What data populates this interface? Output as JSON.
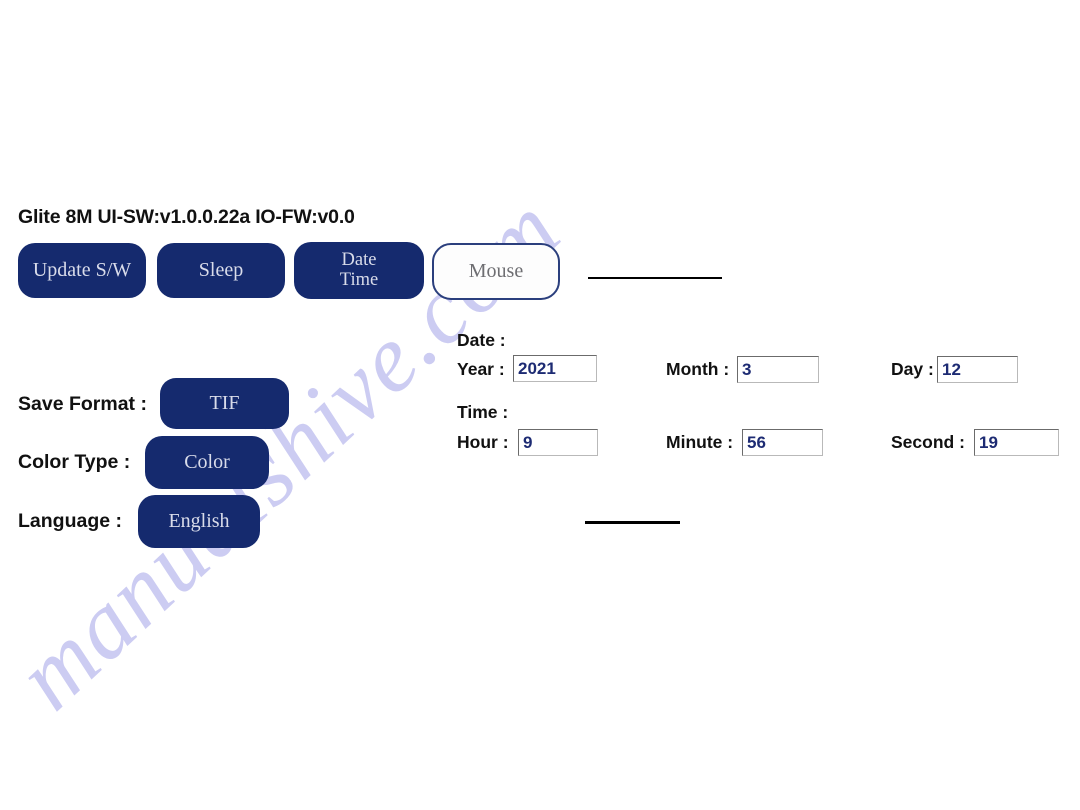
{
  "app": {
    "title": "Glite 8M UI-SW:v1.0.0.22a IO-FW:v0.0",
    "watermark": "manualshive.com",
    "accent_color": "#152a6e",
    "value_text_color": "#1d2b73"
  },
  "toolbar": {
    "update_sw_label": "Update S/W",
    "sleep_label": "Sleep",
    "datetime_label_line1": "Date",
    "datetime_label_line2": "Time",
    "mouse_label": "Mouse"
  },
  "settings": {
    "save_format": {
      "label": "Save Format :",
      "value": "TIF"
    },
    "color_type": {
      "label": "Color Type :",
      "value": "Color"
    },
    "language": {
      "label": "Language :",
      "value": "English"
    }
  },
  "datetime": {
    "date_group_label": "Date :",
    "time_group_label": "Time :",
    "fields": {
      "year": {
        "label": "Year :",
        "value": "2021"
      },
      "month": {
        "label": "Month :",
        "value": "3"
      },
      "day": {
        "label": "Day :",
        "value": "12"
      },
      "hour": {
        "label": "Hour :",
        "value": "9"
      },
      "minute": {
        "label": "Minute :",
        "value": "56"
      },
      "second": {
        "label": "Second :",
        "value": "19"
      }
    }
  }
}
